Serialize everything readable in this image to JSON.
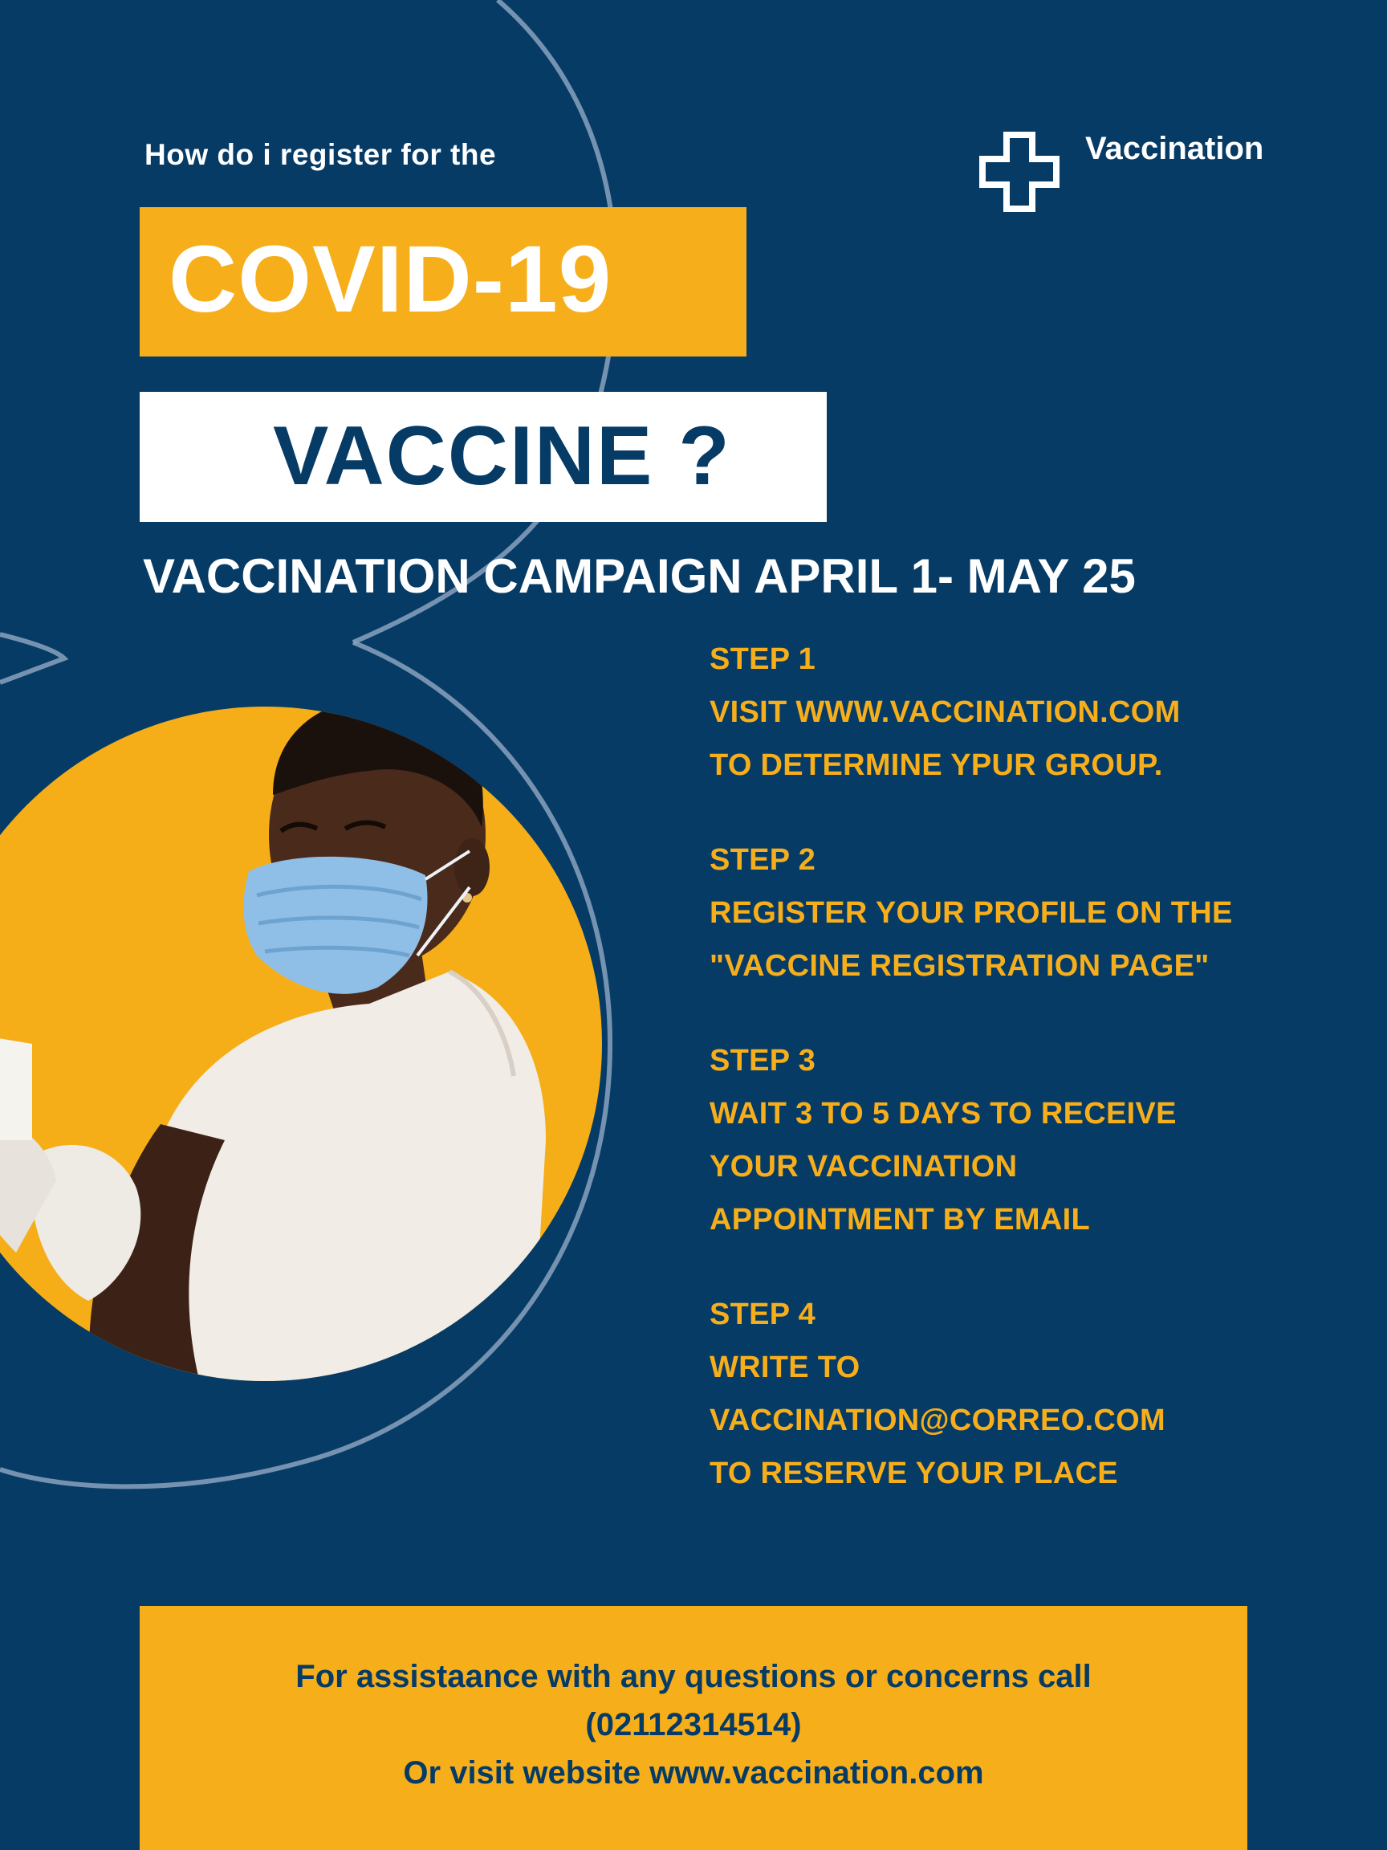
{
  "header": {
    "kicker": "How do i register for the",
    "badge_label": "Vaccination",
    "badge_icon": "plus-cross-icon"
  },
  "title": {
    "line1": "COVID-19",
    "line2": "VACCINE ?"
  },
  "campaign": "VACCINATION CAMPAIGN APRIL 1- MAY 25",
  "steps": [
    {
      "heading": "STEP 1",
      "lines": [
        "VISIT WWW.VACCINATION.COM",
        "TO DETERMINE YPUR GROUP."
      ]
    },
    {
      "heading": "STEP 2",
      "lines": [
        "REGISTER YOUR PROFILE ON THE",
        "\"VACCINE REGISTRATION PAGE\""
      ]
    },
    {
      "heading": "STEP 3",
      "lines": [
        "WAIT 3 TO 5 DAYS TO RECEIVE",
        "YOUR VACCINATION",
        "APPOINTMENT BY EMAIL"
      ]
    },
    {
      "heading": "STEP 4",
      "lines": [
        "WRITE TO",
        "VACCINATION@CORREO.COM",
        "TO RESERVE YOUR PLACE"
      ]
    }
  ],
  "footer": {
    "line1": "For assistaance with any questions or concerns call",
    "line2": "(02112314514)",
    "line3": "Or visit website www.vaccination.com"
  },
  "colors": {
    "background": "#063b66",
    "accent_yellow": "#f7ae1b",
    "white": "#ffffff"
  }
}
